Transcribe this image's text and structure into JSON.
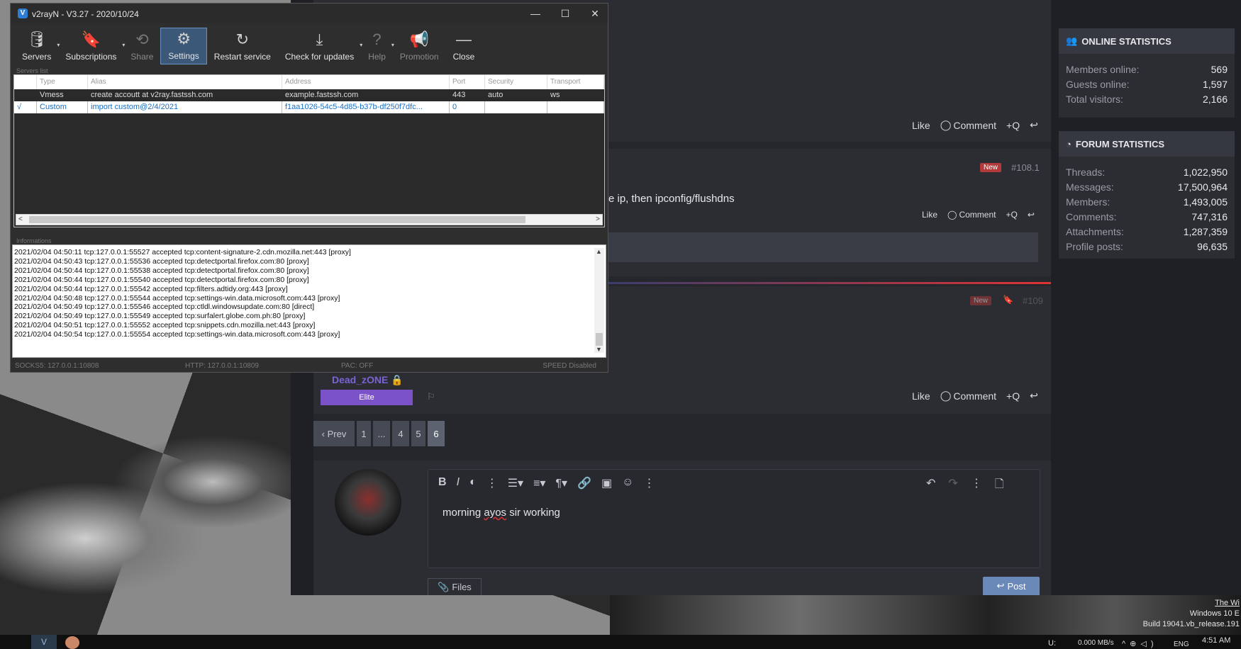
{
  "v2rayn": {
    "title": "v2rayN - V3.27 - 2020/10/24",
    "window_controls": {
      "minimize": "—",
      "maximize": "☐",
      "close": "✕"
    },
    "toolbar": [
      {
        "label": "Servers",
        "icon": "database-icon",
        "glyph": "🛢"
      },
      {
        "label": "Subscriptions",
        "icon": "bookmark-icon",
        "glyph": "🔖"
      },
      {
        "label": "Share",
        "icon": "share-icon",
        "glyph": "⟲"
      },
      {
        "label": "Settings",
        "icon": "gear-icon",
        "glyph": "⚙"
      },
      {
        "label": "Restart service",
        "icon": "restart-icon",
        "glyph": "↻"
      },
      {
        "label": "Check for updates",
        "icon": "download-icon",
        "glyph": "⤓"
      },
      {
        "label": "Help",
        "icon": "help-icon",
        "glyph": "?"
      },
      {
        "label": "Promotion",
        "icon": "megaphone-icon",
        "glyph": "📢"
      },
      {
        "label": "Close",
        "icon": "minus-icon",
        "glyph": "—"
      }
    ],
    "servers_group_label": "Servers list",
    "columns": [
      "Type",
      "Alias",
      "Address",
      "Port",
      "Security",
      "Transport"
    ],
    "servers": [
      {
        "check": "",
        "type": "Vmess",
        "alias": "create accoutt at v2ray.fastssh.com",
        "address": "example.fastssh.com",
        "port": "443",
        "security": "auto",
        "transport": "ws"
      },
      {
        "check": "√",
        "type": "Custom",
        "alias": "import custom@2/4/2021",
        "address": "f1aa1026-54c5-4d85-b37b-df250f7dfc...",
        "port": "0",
        "security": "",
        "transport": ""
      }
    ],
    "info_group_label": "Informations",
    "log": [
      "2021/02/04 04:50:11 tcp:127.0.0.1:55527 accepted tcp:content-signature-2.cdn.mozilla.net:443 [proxy]",
      "2021/02/04 04:50:43 tcp:127.0.0.1:55536 accepted tcp:detectportal.firefox.com:80 [proxy]",
      "2021/02/04 04:50:44 tcp:127.0.0.1:55538 accepted tcp:detectportal.firefox.com:80 [proxy]",
      "2021/02/04 04:50:44 tcp:127.0.0.1:55540 accepted tcp:detectportal.firefox.com:80 [proxy]",
      "2021/02/04 04:50:44 tcp:127.0.0.1:55542 accepted tcp:filters.adtidy.org:443 [proxy]",
      "2021/02/04 04:50:48 tcp:127.0.0.1:55544 accepted tcp:settings-win.data.microsoft.com:443 [proxy]",
      "2021/02/04 04:50:49 tcp:127.0.0.1:55546 accepted tcp:ctldl.windowsupdate.com:80 [direct]",
      "2021/02/04 04:50:49 tcp:127.0.0.1:55549 accepted tcp:surfalert.globe.com.ph:80 [proxy]",
      "2021/02/04 04:50:51 tcp:127.0.0.1:55552 accepted tcp:snippets.cdn.mozilla.net:443 [proxy]",
      "2021/02/04 04:50:54 tcp:127.0.0.1:55554 accepted tcp:settings-win.data.microsoft.com:443 [proxy]"
    ],
    "status": {
      "socks": "SOCKS5:  127.0.0.1:10808",
      "http": "HTTP:  127.0.0.1:10809",
      "pac": "PAC:  OFF",
      "speed": "SPEED Disabled"
    }
  },
  "forum": {
    "actions": {
      "like": "Like",
      "comment": "Comment",
      "quote": "+Q"
    },
    "new_badge": "New",
    "post_108_num": "#108.1",
    "post_109_num": "#109",
    "post_text": "e ip, then ipconfig/flushdns",
    "user_name": "Dead_zONE",
    "user_badge": "Elite",
    "pager": {
      "prev": "‹ Prev",
      "pages": [
        "1",
        "...",
        "4",
        "5",
        "6"
      ]
    },
    "editor_text_a": "morning ",
    "editor_text_b": "ayos",
    "editor_text_c": " sir working",
    "files_label": "Files",
    "post_label": "Post"
  },
  "sidebar": {
    "online": {
      "title": "ONLINE STATISTICS",
      "rows": [
        {
          "k": "Members online:",
          "v": "569"
        },
        {
          "k": "Guests online:",
          "v": "1,597"
        },
        {
          "k": "Total visitors:",
          "v": "2,166"
        }
      ]
    },
    "forum": {
      "title": "FORUM STATISTICS",
      "rows": [
        {
          "k": "Threads:",
          "v": "1,022,950"
        },
        {
          "k": "Messages:",
          "v": "17,500,964"
        },
        {
          "k": "Members:",
          "v": "1,493,005"
        },
        {
          "k": "Comments:",
          "v": "747,316"
        },
        {
          "k": "Attachments:",
          "v": "1,287,359"
        },
        {
          "k": "Profile posts:",
          "v": "96,635"
        }
      ]
    }
  },
  "taskbar": {
    "net": "U:",
    "speed": "0.000 MB/s",
    "lang": "ENG",
    "clock": "4:51 AM"
  },
  "watermark": {
    "line1": "The Wi",
    "line2": "Windows 10 E",
    "line3": "Build 19041.vb_release.191"
  }
}
